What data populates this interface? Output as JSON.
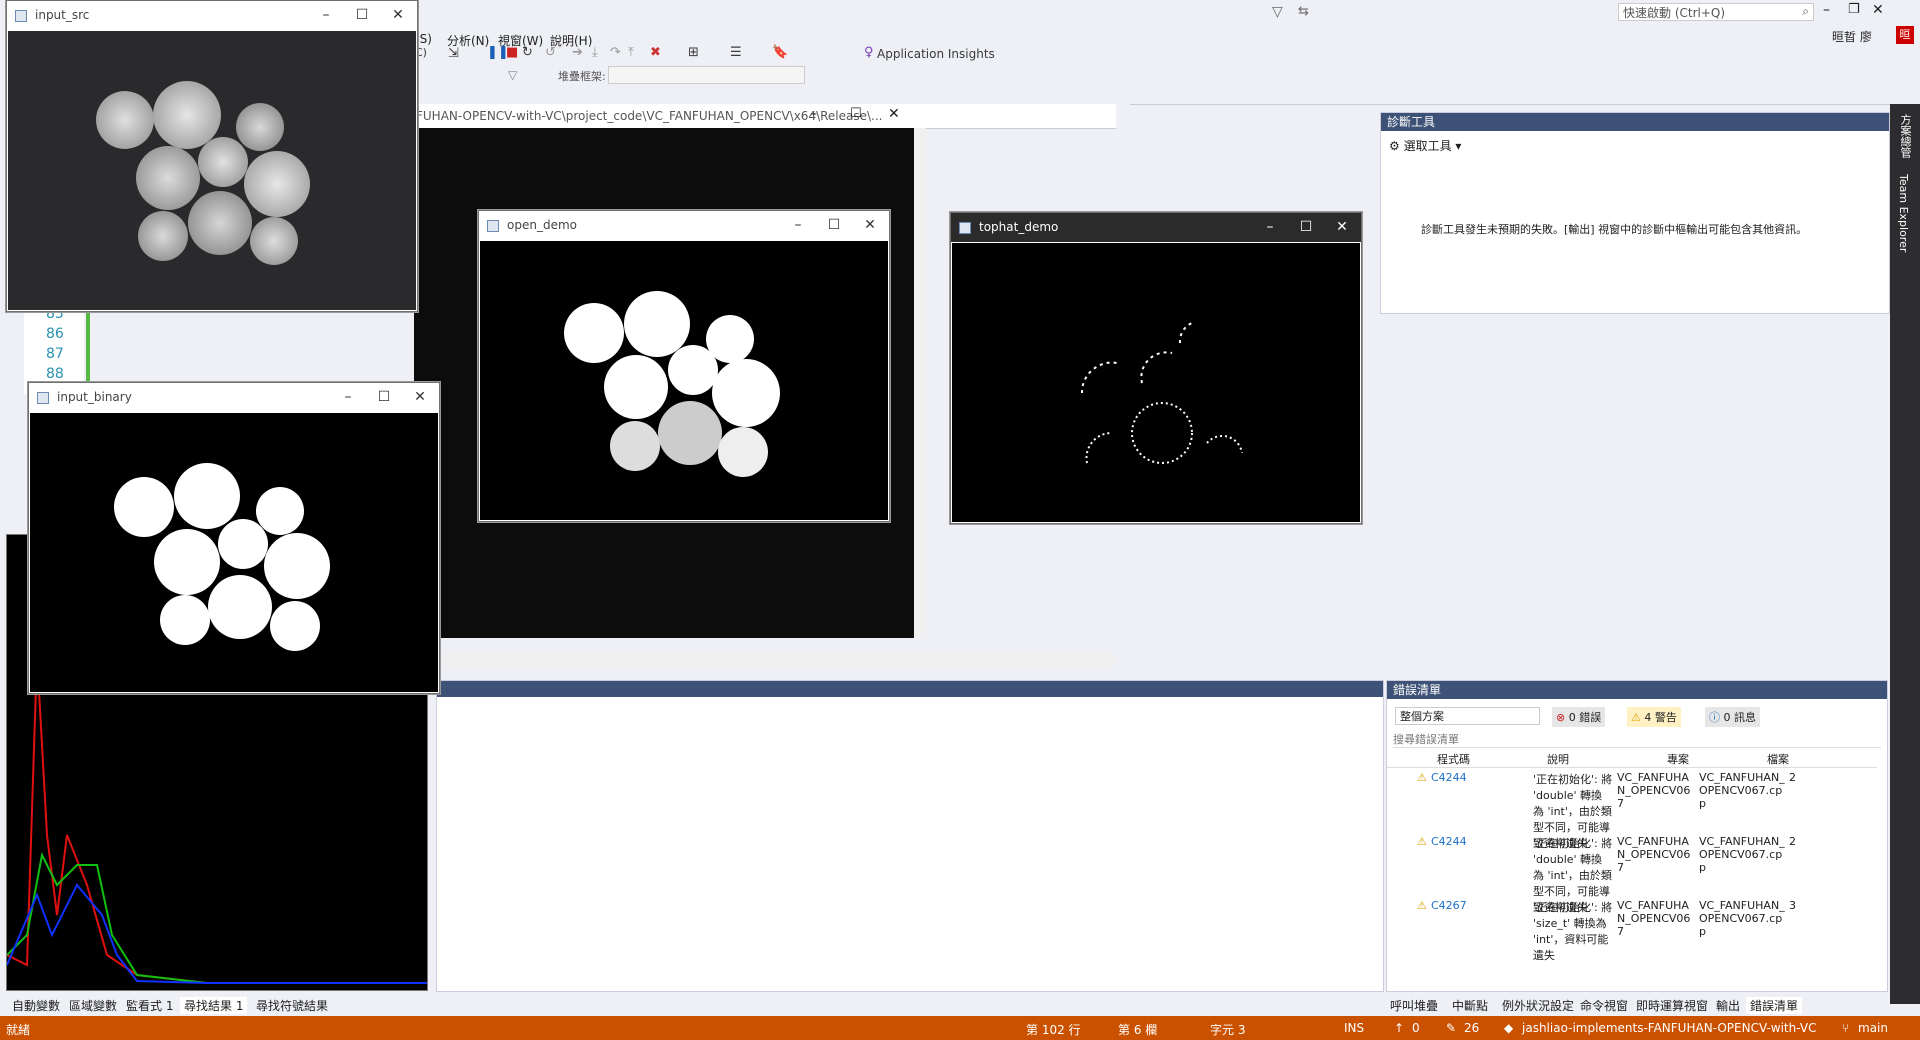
{
  "menubar": {
    "items": [
      "(S)",
      "分析(N)",
      "視窗(W)",
      "說明(H)"
    ],
    "quick_launch_placeholder": "快速啟動 (Ctrl+Q)",
    "user_name": "晅晢 廖",
    "avatar_text": "晅"
  },
  "toolbar": {
    "insights_label": "Application Insights",
    "stack_frame_label": "堆疊框架:",
    "config_partial": "C)"
  },
  "code_editor": {
    "path_text": "FUHAN-OPENCV-with-VC\\project_code\\VC_FANFUHAN_OPENCV\\x64\\Release\\...",
    "line_numbers": [
      "85",
      "86",
      "87",
      "88"
    ]
  },
  "windows": {
    "input_src": {
      "title": "input_src"
    },
    "input_binary": {
      "title": "input_binary"
    },
    "open_demo": {
      "title": "open_demo"
    },
    "tophat_demo": {
      "title": "tophat_demo"
    }
  },
  "diag_tools": {
    "title": "診斷工具",
    "select_tools": "選取工具 ▾",
    "message": "診斷工具發生未預期的失敗。[輸出] 視窗中的診斷中樞輸出可能包含其他資訊。"
  },
  "side_tabs": {
    "solution_explorer": "方案總管",
    "team_explorer": "Team Explorer"
  },
  "error_list": {
    "title": "錯誤清單",
    "scope": "整個方案",
    "errors_badge": "0 錯誤",
    "warnings_badge": "4 警告",
    "messages_badge": "0 訊息",
    "search_placeholder": "搜尋錯誤清單",
    "columns": [
      "程式碼",
      "說明",
      "專案",
      "檔案"
    ],
    "rows": [
      {
        "code": "C4244",
        "desc": "'正在初始化': 將 'double' 轉換為 'int'，由於類型不同，可能導致資料遺失",
        "project": "VC_FANFUHAN_OPENCV067",
        "file": "VC_FANFUHAN_OPENCV067.cpp",
        "line": "2"
      },
      {
        "code": "C4244",
        "desc": "'正在初始化': 將 'double' 轉換為 'int'，由於類型不同，可能導致資料遺失",
        "project": "VC_FANFUHAN_OPENCV067",
        "file": "VC_FANFUHAN_OPENCV067.cpp",
        "line": "2"
      },
      {
        "code": "C4267",
        "desc": "'正在初始化': 將 'size_t' 轉換為 'int'，資料可能遺失",
        "project": "VC_FANFUHAN_OPENCV067",
        "file": "VC_FANFUHAN_OPENCV067.cpp",
        "line": "3"
      }
    ]
  },
  "bottom_tabs_left": [
    "自動變數",
    "區域變數",
    "監看式 1",
    "尋找結果 1",
    "尋找符號結果"
  ],
  "bottom_tabs_right": [
    "呼叫堆疊",
    "中斷點",
    "例外狀況設定",
    "命令視窗",
    "即時運算視窗",
    "輸出",
    "錯誤清單"
  ],
  "statusbar": {
    "ready": "就緒",
    "line": "第 102 行",
    "col": "第 6 欄",
    "char": "字元 3",
    "ins": "INS",
    "up_count": "0",
    "edit_count": "26",
    "repo": "jashliao-implements-FANFUHAN-OPENCV-with-VC",
    "branch": "main"
  },
  "colors": {
    "status": "#ca5100",
    "accent": "#007acc",
    "warning": "#f0c000"
  }
}
